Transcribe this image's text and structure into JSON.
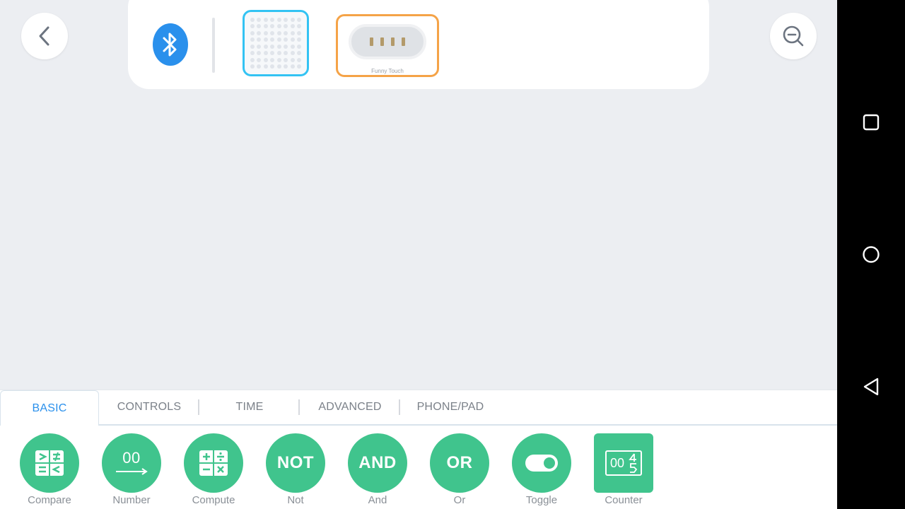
{
  "header": {
    "back_icon": "chevron-left-icon",
    "zoom_icon": "zoom-out-icon",
    "bluetooth_icon": "bluetooth-icon",
    "devices": [
      {
        "name": "led-matrix",
        "border_color": "#33c3f3"
      },
      {
        "name": "funny-touch",
        "label": "Funny Touch",
        "border_color": "#f5a347"
      }
    ]
  },
  "tabs": [
    {
      "label": "BASIC",
      "active": true
    },
    {
      "label": "CONTROLS",
      "active": false
    },
    {
      "label": "TIME",
      "active": false
    },
    {
      "label": "ADVANCED",
      "active": false
    },
    {
      "label": "PHONE/PAD",
      "active": false
    }
  ],
  "blocks": [
    {
      "label": "Compare",
      "icon": "compare-icon"
    },
    {
      "label": "Number",
      "icon": "number-icon",
      "glyph": "00"
    },
    {
      "label": "Compute",
      "icon": "compute-icon"
    },
    {
      "label": "Not",
      "icon": "not-icon",
      "glyph": "NOT"
    },
    {
      "label": "And",
      "icon": "and-icon",
      "glyph": "AND"
    },
    {
      "label": "Or",
      "icon": "or-icon",
      "glyph": "OR"
    },
    {
      "label": "Toggle",
      "icon": "toggle-icon"
    },
    {
      "label": "Counter",
      "icon": "counter-icon",
      "glyph": "00"
    }
  ],
  "colors": {
    "accent_blue": "#2a90ec",
    "block_green": "#40c48d",
    "canvas_bg": "#eceef2"
  },
  "nav": {
    "recents_icon": "square-icon",
    "home_icon": "circle-icon",
    "back_icon": "triangle-back-icon"
  }
}
